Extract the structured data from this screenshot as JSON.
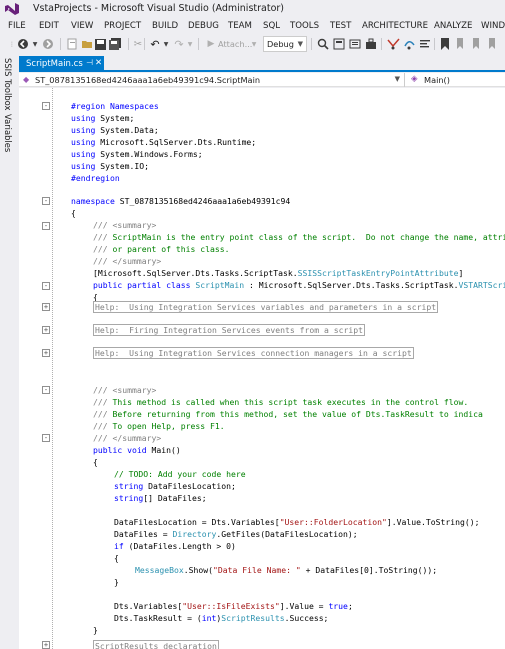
{
  "window": {
    "title": "VstaProjects - Microsoft Visual Studio (Administrator)"
  },
  "menu": [
    "FILE",
    "EDIT",
    "VIEW",
    "PROJECT",
    "BUILD",
    "DEBUG",
    "TEAM",
    "SQL",
    "TOOLS",
    "TEST",
    "ARCHITECTURE",
    "ANALYZE",
    "WINDOW"
  ],
  "toolbar": {
    "attach_label": "Attach...",
    "configuration": "Debug"
  },
  "side_tabs": [
    "SSIS Toolbox",
    "Variables"
  ],
  "document_tab": {
    "label": "ScriptMain.cs"
  },
  "navigation": {
    "class": "ST_0878135168ed4246aaa1a6eb49391c94.ScriptMain",
    "member": "Main()"
  },
  "colors": {
    "accent": "#007acc",
    "keyword": "#0000ff",
    "comment": "#008000",
    "type": "#2b91af",
    "string": "#a31515"
  },
  "code": {
    "region_start": "#region Namespaces",
    "using_kw": "using",
    "usings": [
      "System;",
      "System.Data;",
      "Microsoft.SqlServer.Dts.Runtime;",
      "System.Windows.Forms;",
      "System.IO;"
    ],
    "region_end": "#endregion",
    "namespace_kw": "namespace",
    "namespace_name": "ST_0878135168ed4246aaa1a6eb49391c94",
    "open_brace": "{",
    "close_brace": "}",
    "doc_prefix": "/// ",
    "summary_open": "<summary>",
    "summary_close": "</summary>",
    "class_doc_1": "ScriptMain is the entry point class of the script.  Do not change the name, attri",
    "class_doc_2": "or parent of this class.",
    "attribute_prefix": "[Microsoft.SqlServer.Dts.Tasks.ScriptTask.",
    "attribute_type": "SSISScriptTaskEntryPointAttribute",
    "attribute_suffix": "]",
    "class_decl_kw": "public partial class",
    "class_name": "ScriptMain",
    "class_base_prefix": " : Microsoft.SqlServer.Dts.Tasks.ScriptTask.",
    "class_base_type": "VSTARTScri",
    "collapsed_regions": [
      "Help:  Using Integration Services variables and parameters in a script",
      "Help:  Firing Integration Services events from a script",
      "Help:  Using Integration Services connection managers in a script"
    ],
    "main_doc_1": "This method is called when this script task executes in the control flow.",
    "main_doc_2": "Before returning from this method, set the value of Dts.TaskResult to indica",
    "main_doc_3": "To open Help, press F1.",
    "main_decl_kw": "public void",
    "main_decl_name": " Main()",
    "todo_comment": "// TODO: Add your code here",
    "string_kw": "string",
    "decl_1": " DataFilesLocation;",
    "string_array_kw": "string",
    "decl_2": "[] DataFiles;",
    "assign_1_a": "DataFilesLocation = Dts.Variables[",
    "assign_1_str": "\"User::FolderLocation\"",
    "assign_1_b": "].Value.ToString();",
    "assign_2_a": "DataFiles = ",
    "assign_2_type": "Directory",
    "assign_2_b": ".GetFiles(DataFilesLocation);",
    "if_kw": "if",
    "if_cond": " (DataFiles.Length > 0)",
    "msg_type": "MessageBox",
    "msg_a": ".Show(",
    "msg_str": "\"Data File Name: \"",
    "msg_b": " + DataFiles[0].ToString());",
    "assign_3_a": "Dts.Variables[",
    "assign_3_str": "\"User::IsFileExists\"",
    "assign_3_b": "].Value = ",
    "true_kw": "true",
    "semicolon": ";",
    "assign_4_a": "Dts.TaskResult = (",
    "int_kw": "int",
    "assign_4_b": ")",
    "results_type": "ScriptResults",
    "assign_4_c": ".Success;",
    "bottom_region": "ScriptResults declaration"
  }
}
